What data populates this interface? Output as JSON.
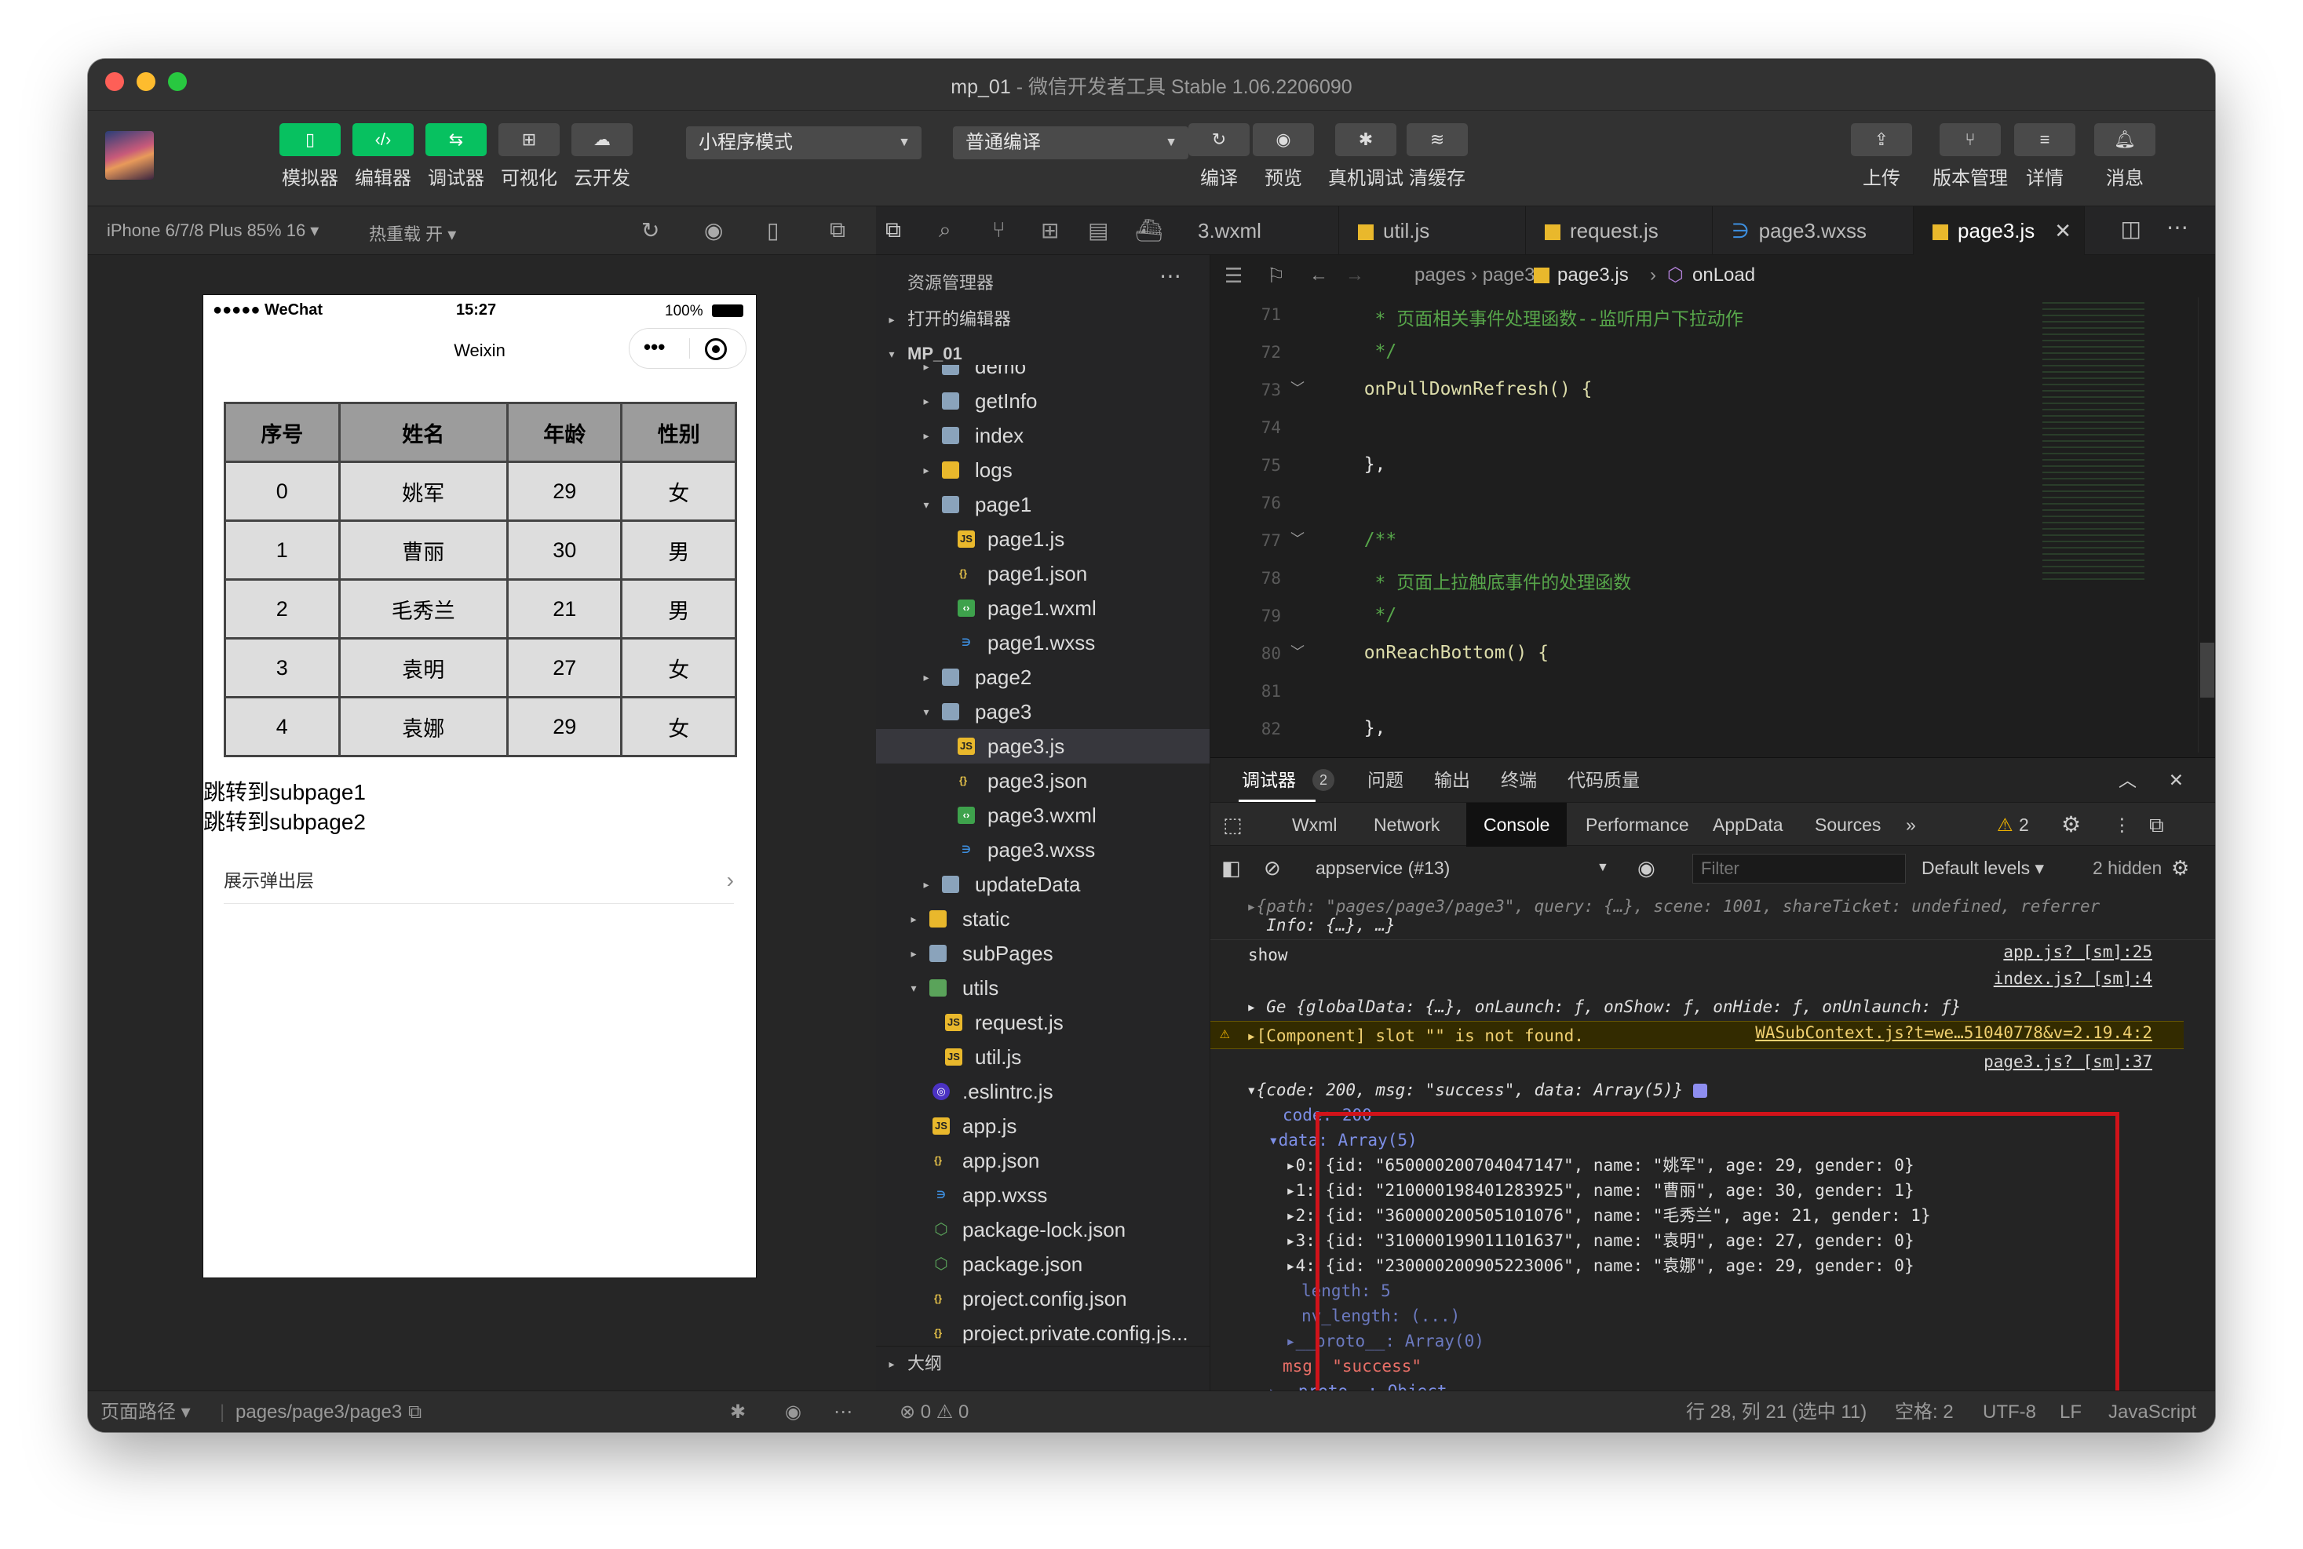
{
  "window": {
    "title_project": "mp_01",
    "title_rest": " - 微信开发者工具 Stable 1.06.2206090"
  },
  "toolbar": {
    "buttons": [
      {
        "label": "模拟器",
        "icon": "phone-icon"
      },
      {
        "label": "编辑器",
        "icon": "code-icon"
      },
      {
        "label": "调试器",
        "icon": "debug-toggle-icon"
      },
      {
        "label": "可视化",
        "icon": "layout-icon"
      },
      {
        "label": "云开发",
        "icon": "cloud-icon"
      }
    ],
    "mode_select": "小程序模式",
    "compile_select": "普通编译",
    "actions": [
      "编译",
      "预览",
      "真机调试",
      "清缓存"
    ],
    "right": [
      "上传",
      "版本管理",
      "详情",
      "消息"
    ]
  },
  "simulator": {
    "device": "iPhone 6/7/8 Plus 85% 16 ▾",
    "hotreload": "热重载 开 ▾"
  },
  "phone": {
    "carrier": "●●●●● WeChat",
    "time": "15:27",
    "battery": "100%",
    "nav_title": "Weixin",
    "table": {
      "headers": [
        "序号",
        "姓名",
        "年龄",
        "性别"
      ],
      "rows": [
        [
          "0",
          "姚军",
          "29",
          "女"
        ],
        [
          "1",
          "曹丽",
          "30",
          "男"
        ],
        [
          "2",
          "毛秀兰",
          "21",
          "男"
        ],
        [
          "3",
          "袁明",
          "27",
          "女"
        ],
        [
          "4",
          "袁娜",
          "29",
          "女"
        ]
      ]
    },
    "links": [
      "跳转到subpage1",
      "跳转到subpage2"
    ],
    "cell": "展示弹出层"
  },
  "explorer": {
    "title": "资源管理器",
    "open_editors": "打开的编辑器",
    "project": "MP_01",
    "outline": "大纲",
    "items": [
      "demo",
      "getInfo",
      "index",
      "logs",
      "page1",
      "page1.js",
      "page1.json",
      "page1.wxml",
      "page1.wxss",
      "page2",
      "page3",
      "page3.js",
      "page3.json",
      "page3.wxml",
      "page3.wxss",
      "updateData",
      "static",
      "subPages",
      "utils",
      "request.js",
      "util.js",
      ".eslintrc.js",
      "app.js",
      "app.json",
      "app.wxss",
      "package-lock.json",
      "package.json",
      "project.config.json",
      "project.private.config.js..."
    ]
  },
  "tabs": [
    "3.wxml",
    "util.js",
    "request.js",
    "page3.wxss",
    "page3.js"
  ],
  "breadcrumb": {
    "path": "pages › page3 ›",
    "file": "page3.js",
    "symbol": "onLoad"
  },
  "code": {
    "numbers": [
      "71",
      "72",
      "73",
      "74",
      "75",
      "76",
      "77",
      "78",
      "79",
      "80",
      "81",
      "82"
    ],
    "lines": [
      "   * 页面相关事件处理函数--监听用户下拉动作",
      "   */",
      "  onPullDownRefresh() {",
      "",
      "  },",
      "",
      "  /**",
      "   * 页面上拉触底事件的处理函数",
      "   */",
      "  onReachBottom() {",
      "",
      "  },"
    ]
  },
  "devtools": {
    "panel_tabs": [
      "调试器",
      "问题",
      "输出",
      "终端",
      "代码质量"
    ],
    "badge": "2",
    "tabs": [
      "Wxml",
      "Network",
      "Console",
      "Performance",
      "AppData",
      "Sources"
    ],
    "warn_count": "2",
    "context": "appservice (#13)",
    "filter_placeholder": "Filter",
    "levels": "Default levels ▾",
    "hidden": "2 hidden"
  },
  "console": {
    "l0": "▸{path: \"pages/page3/page3\", query: {…}, scene: 1001, shareTicket: undefined, referrer",
    "l1": "  Info: {…}, …}",
    "show": "show",
    "show_src": "app.js? [sm]:25",
    "idx_src": "index.js? [sm]:4",
    "ge": "▸ Ge {globalData: {…}, onLaunch: ƒ, onShow: ƒ, onHide: ƒ, onUnlaunch: ƒ}",
    "warn": "▸[Component] slot \"\" is not found.",
    "warn_src": "WASubContext.js?t=we…51040778&v=2.19.4:2",
    "p3_src": "page3.js? [sm]:37",
    "obj": "▾{code: 200, msg: \"success\", data: Array(5)}",
    "code": "code: 200",
    "data": "▾data: Array(5)",
    "entries": [
      "▸0: {id: \"650000200704047147\", name: \"姚军\", age: 29, gender: 0}",
      "▸1: {id: \"210000198401283925\", name: \"曹丽\", age: 30, gender: 1}",
      "▸2: {id: \"360000200505101076\", name: \"毛秀兰\", age: 21, gender: 1}",
      "▸3: {id: \"310000199011101637\", name: \"袁明\", age: 27, gender: 0}",
      "▸4: {id: \"230000200905223006\", name: \"袁娜\", age: 29, gender: 0}"
    ],
    "length": "length: 5",
    "nvlen": "nv_length: (...)",
    "proto0": "▸__proto__: Array(0)",
    "msg": "msg: \"success\"",
    "proto": "▸__proto__: Object"
  },
  "statusbar": {
    "path_label": "页面路径 ▾",
    "path": "pages/page3/page3",
    "errors": "⊗ 0 ⚠ 0",
    "pos": "行 28, 列 21 (选中 11)",
    "spaces": "空格: 2",
    "enc": "UTF-8",
    "eol": "LF",
    "lang": "JavaScript"
  },
  "colors": {
    "green": "#07c160",
    "red_box": "#d0131a",
    "bg": "#1e1e1e"
  }
}
